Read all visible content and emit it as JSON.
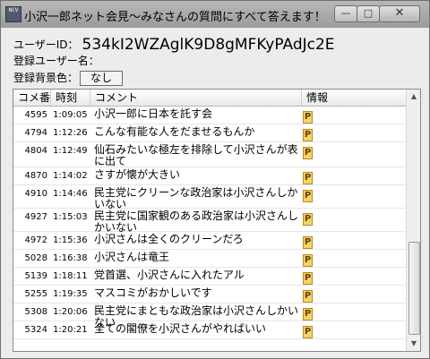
{
  "window": {
    "title": "小沢一郎ネット会見～みなさんの質問にすべて答えます！ - ...",
    "app_icon_text": "NCV",
    "minimize_glyph": "—",
    "maximize_glyph": "□",
    "close_glyph": "✕"
  },
  "info": {
    "user_id_label": "ユーザーID：",
    "user_id_value": "534kI2WZAglK9D8gMFKyPAdJc2E",
    "user_name_label": "登録ユーザー名：",
    "bg_color_label": "登録背景色：",
    "bg_color_value": "なし"
  },
  "list": {
    "headers": {
      "num": "コメ番",
      "time": "時刻",
      "comment": "コメント",
      "info": "情報"
    },
    "rows": [
      {
        "num": "4595",
        "time": "1:09:05",
        "comment": "小沢一郎に日本を託す会",
        "info": "P"
      },
      {
        "num": "4794",
        "time": "1:12:26",
        "comment": "こんな有能な人をだませるもんか",
        "info": "P"
      },
      {
        "num": "4804",
        "time": "1:12:49",
        "comment": "仙石みたいな極左を排除して小沢さんが表に出て",
        "info": "P"
      },
      {
        "num": "4870",
        "time": "1:14:02",
        "comment": "さすが懐が大きい",
        "info": "P"
      },
      {
        "num": "4910",
        "time": "1:14:46",
        "comment": "民主党にクリーンな政治家は小沢さんしかいない",
        "info": "P"
      },
      {
        "num": "4927",
        "time": "1:15:03",
        "comment": "民主党に国家観のある政治家は小沢さんしかいない",
        "info": "P"
      },
      {
        "num": "4972",
        "time": "1:15:36",
        "comment": "小沢さんは全くのクリーンだろ",
        "info": "P"
      },
      {
        "num": "5028",
        "time": "1:16:38",
        "comment": "小沢さんは竜王",
        "info": "P"
      },
      {
        "num": "5139",
        "time": "1:18:11",
        "comment": "党首選、小沢さんに入れたアル",
        "info": "P"
      },
      {
        "num": "5255",
        "time": "1:19:35",
        "comment": "マスコミがおかしいです",
        "info": "P"
      },
      {
        "num": "5308",
        "time": "1:20:06",
        "comment": "民主党にまともな政治家は小沢さんしかいない",
        "info": "P"
      },
      {
        "num": "5324",
        "time": "1:20:21",
        "comment": "全ての閣僚を小沢さんがやればいい",
        "info": "P"
      }
    ]
  },
  "colors": {
    "premium_icon": "#f5d46a"
  },
  "icons": {
    "premium": "premium-p-icon"
  }
}
